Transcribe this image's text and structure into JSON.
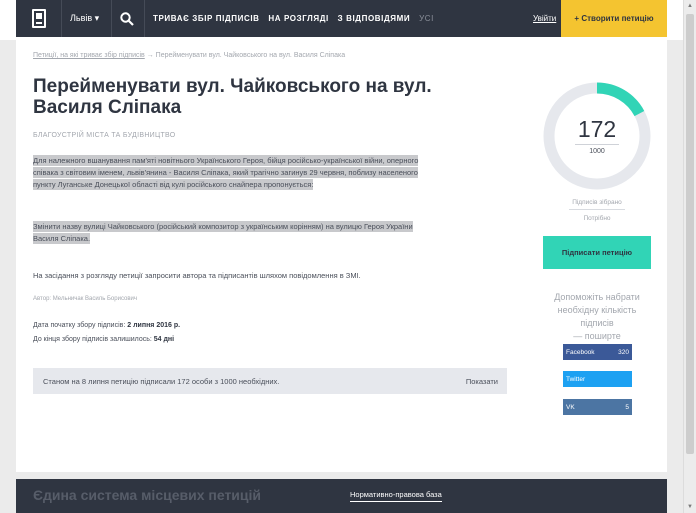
{
  "header": {
    "city": "Львів ▾",
    "nav": [
      "ТРИВАЄ ЗБІР ПІДПИСІВ",
      "НА РОЗГЛЯДІ",
      "З ВІДПОВІДЯМИ",
      "УСІ"
    ],
    "login": "Увійти",
    "create_button": "+ Створити петицію"
  },
  "breadcrumb": {
    "parent": "Петиції, на які триває збір підписів",
    "separator": " → ",
    "current": "Перейменувати вул. Чайковського на вул. Василя Сліпака"
  },
  "petition": {
    "title": "Перейменувати вул. Чайковського на вул. Василя Сліпака",
    "category": "БЛАГОУСТРІЙ МІСТА ТА БУДІВНИЦТВО",
    "paragraph1_lines": [
      "Для належного вшанування пам'яті новітнього Українського Героя, бійця російсько-української війни, оперного",
      "співака з світовим іменем, львів'янина - Василя Сліпака, який трагічно загинув 29 червня, поблизу населеного",
      "пункту Луганське Донецької області від кулі російського снайпера пропонується:"
    ],
    "paragraph2_lines": [
      "Змінити назву вулиці Чайковського (російський композитор з українським корінням) на вулицю Героя України",
      "Василя Сліпака."
    ],
    "paragraph3": "На засідання з розгляду петиції запросити автора та підписантів шляхом повідомлення в ЗМІ.",
    "author": "Автор: Мельничак Василь Борисович",
    "start_label": "Дата початку збору підписів: ",
    "start_value": "2 липня 2016 р.",
    "remaining_label": "До кінця збору підписів залишилось: ",
    "remaining_value": "54 дні",
    "status_text": "Станом на 8 липня петицію підписали 172 особи з 1000 необхідних.",
    "show_link": "Показати"
  },
  "sidebar": {
    "signatures": "172",
    "goal": "1000",
    "signatures_progress": 0.172,
    "collected_label": "Підписів зібрано",
    "needed_label": "Потрібно",
    "sign_button": "Підписати петицію",
    "help_text_lines": [
      "Допоможіть набрати",
      "необхідну кількість підписів",
      "— поширте"
    ],
    "share": [
      {
        "name": "Facebook",
        "count": "320",
        "color": "#3b5998"
      },
      {
        "name": "Twitter",
        "count": "",
        "color": "#1da1f2"
      },
      {
        "name": "VK",
        "count": "5",
        "color": "#4c75a3"
      }
    ]
  },
  "footer": {
    "title": "Єдина система місцевих петицій",
    "link": "Нормативно-правова база"
  },
  "colors": {
    "dark": "#2f3541",
    "accent_yellow": "#f4c430",
    "accent_teal": "#31d4b6"
  }
}
